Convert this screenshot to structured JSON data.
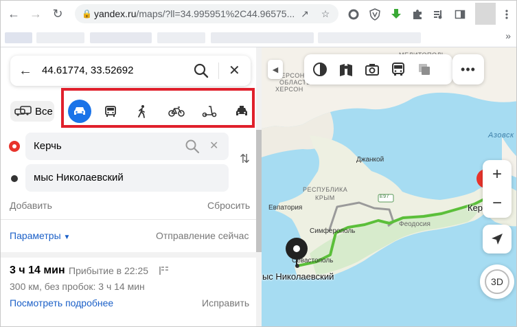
{
  "browser": {
    "url_host": "yandex.ru",
    "url_path": "/maps/?ll=34.995951%2C44.96575..."
  },
  "search": {
    "value": "44.61774, 33.52692"
  },
  "modes": {
    "all_label": "Все",
    "items": [
      "car",
      "bus",
      "walk",
      "bike",
      "scooter",
      "taxi"
    ],
    "active": "car",
    "highlight_color": "#e0202c",
    "active_color": "#1a73e8"
  },
  "route": {
    "from": "Керчь",
    "to": "мыс Николаевский",
    "add_label": "Добавить",
    "reset_label": "Сбросить",
    "params_label": "Параметры",
    "depart_label": "Отправление сейчас"
  },
  "result": {
    "duration": "3 ч 14 мин",
    "arrival": "Прибытие в 22:25",
    "details": "300 км, без пробок: 3 ч 14 мин",
    "more_label": "Посмотреть подробнее",
    "fix_label": "Исправить"
  },
  "map": {
    "labels": {
      "melitopol": "МЕЛИТОПОЛЬ",
      "kherson_region_1": "ХЕРСОНСКАЯ",
      "kherson_region_2": "ОБЛАСТЬ",
      "kherson": "ХЕРСОН",
      "azov": "Азовск",
      "dzhankoy": "Джанкой",
      "crimea_1": "РЕСПУБЛИКА",
      "crimea_2": "КРЫМ",
      "e97": "E97",
      "evpatoria": "Евпатория",
      "simferopol": "Симферополь",
      "feodosia": "Феодосия",
      "sevastopol": "Севастополь",
      "kerch": "Кер",
      "destination": "мыс Николаевский",
      "btn3d": "3D"
    },
    "route_color": "#5bbf3a",
    "alt_route_color": "#9a9a9a"
  }
}
